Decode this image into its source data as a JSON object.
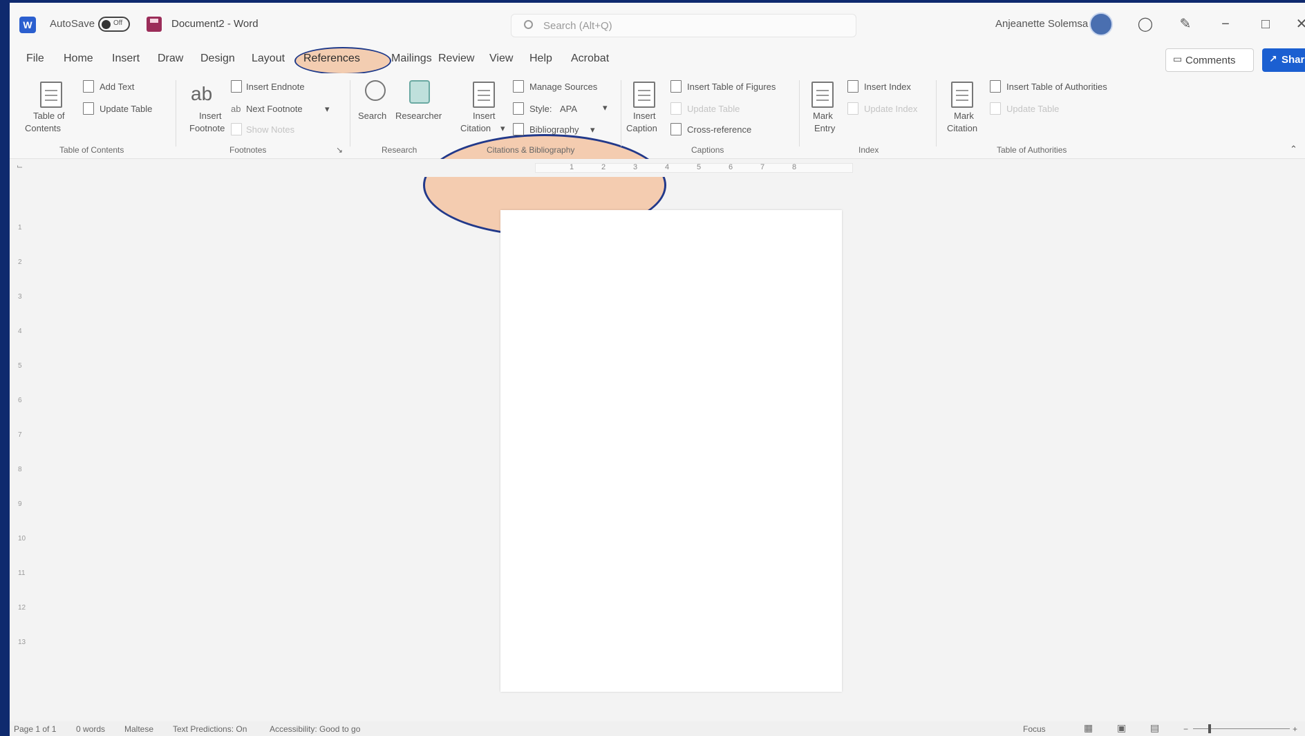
{
  "titlebar": {
    "autosave_label": "AutoSave",
    "autosave_state": "Off",
    "document_name": "Document2 - Word",
    "search_placeholder": "Search (Alt+Q)",
    "user_name": "Anjeanette Solemsa",
    "minimize": "−",
    "restore": "□",
    "close": "✕"
  },
  "tabs": [
    "File",
    "Home",
    "Insert",
    "Draw",
    "Design",
    "Layout",
    "References",
    "Mailings",
    "Review",
    "View",
    "Help",
    "Acrobat"
  ],
  "active_tab": "References",
  "actions": {
    "comments": "Comments",
    "share": "Share"
  },
  "ribbon": {
    "toc": {
      "table_of_contents": "Table of",
      "table_of_contents_2": "Contents",
      "add_text": "Add Text",
      "update_table": "Update Table",
      "group": "Table of Contents"
    },
    "footnotes": {
      "insert_footnote": "Insert",
      "insert_footnote_2": "Footnote",
      "insert_endnote": "Insert Endnote",
      "next_footnote": "Next Footnote",
      "show_notes": "Show Notes",
      "group": "Footnotes"
    },
    "research": {
      "search": "Search",
      "researcher": "Researcher",
      "group": "Research"
    },
    "citations": {
      "insert_citation": "Insert",
      "insert_citation_2": "Citation",
      "manage_sources": "Manage Sources",
      "style_label": "Style:",
      "style_value": "APA",
      "bibliography": "Bibliography",
      "group": "Citations & Bibliography"
    },
    "captions": {
      "insert_caption": "Insert",
      "insert_caption_2": "Caption",
      "insert_table_of_figures": "Insert Table of Figures",
      "update_table": "Update Table",
      "cross_reference": "Cross-reference",
      "group": "Captions"
    },
    "index": {
      "mark_entry": "Mark",
      "mark_entry_2": "Entry",
      "insert_index": "Insert Index",
      "update_index": "Update Index",
      "group": "Index"
    },
    "authorities": {
      "mark_citation": "Mark",
      "mark_citation_2": "Citation",
      "insert_table_of_authorities": "Insert Table of Authorities",
      "update_table": "Update Table",
      "group": "Table of Authorities"
    }
  },
  "ruler": {
    "marks": [
      "1",
      "2",
      "3",
      "4",
      "5",
      "6",
      "7",
      "8"
    ],
    "vertical_marks": [
      "1",
      "2",
      "3",
      "4",
      "5",
      "6",
      "7",
      "8",
      "9",
      "10",
      "11",
      "12",
      "13"
    ]
  },
  "status": {
    "page": "Page 1 of 1",
    "words": "0 words",
    "language": "Maltese",
    "predictions": "Text Predictions: On",
    "accessibility": "Accessibility: Good to go",
    "focus": "Focus"
  },
  "colors": {
    "frame": "#0f2a6e",
    "highlight_fill": "#f3c4a3",
    "highlight_border": "#22398a",
    "share_button": "#1b5fd1"
  }
}
